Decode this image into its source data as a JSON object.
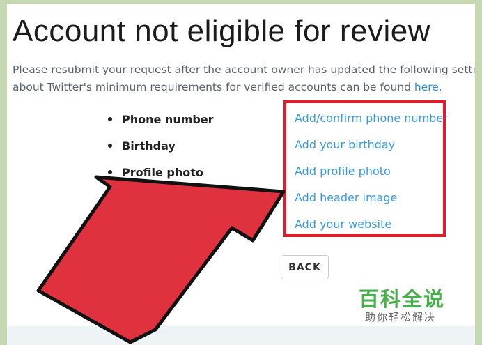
{
  "page": {
    "title": "Account not eligible for review",
    "description_line1": "Please resubmit your request after the account owner has updated the following settings",
    "description_line2": "about Twitter's minimum requirements for verified accounts can be found",
    "here_link": "here."
  },
  "requirements": [
    "Phone number",
    "Birthday",
    "Profile photo"
  ],
  "actions": [
    "Add/confirm phone number",
    "Add your birthday",
    "Add profile photo",
    "Add header image",
    "Add your website"
  ],
  "back_button": "BACK",
  "watermark": {
    "title": "百科全说",
    "subtitle": "助你轻松解决"
  },
  "colors": {
    "highlight": "#e11b2a",
    "arrow": "#e0313f",
    "link": "#3a9ae0",
    "background": "#c5d8b2"
  },
  "icons": [
    "pointer-arrow-icon"
  ]
}
